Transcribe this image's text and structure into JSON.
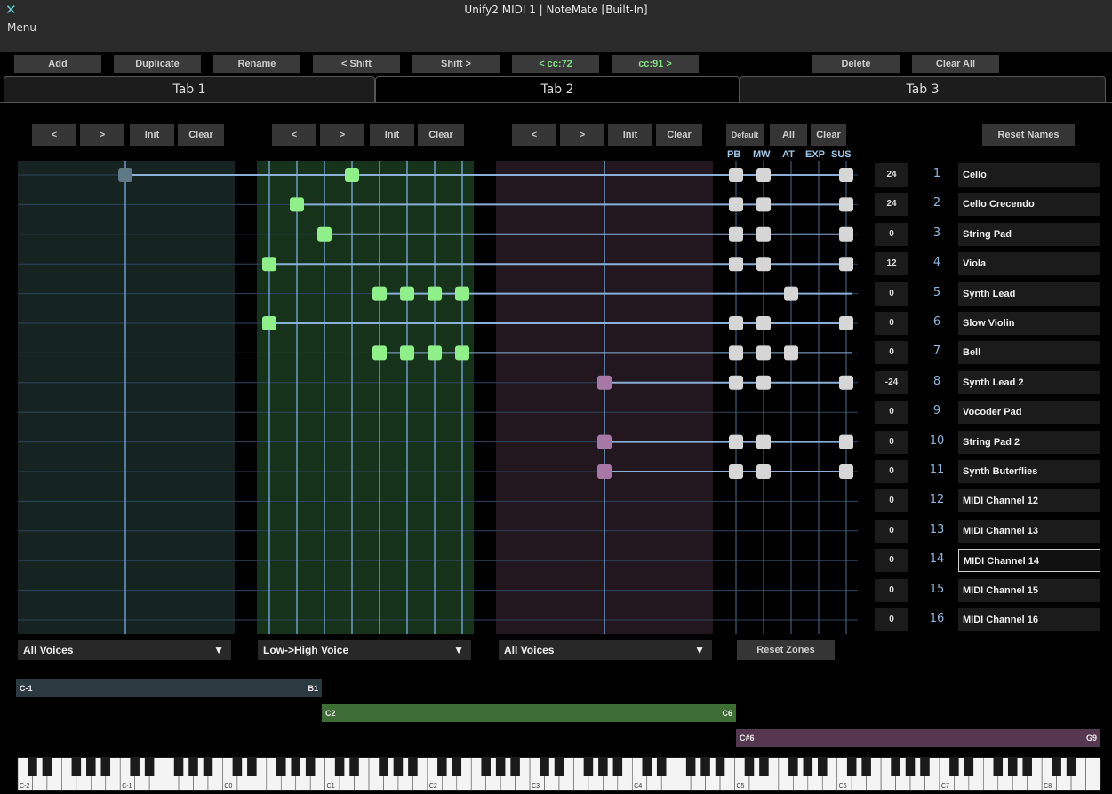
{
  "window": {
    "title": "Unify2 MIDI 1 | NoteMate [Built-In]"
  },
  "menu": {
    "label": "Menu"
  },
  "toolbar": {
    "add": "Add",
    "duplicate": "Duplicate",
    "rename": "Rename",
    "shift_left": "< Shift",
    "shift_right": "Shift >",
    "cc_prev": "< cc:72",
    "cc_next": "cc:91 >",
    "delete": "Delete",
    "clear_all": "Clear All"
  },
  "tabs": [
    "Tab 1",
    "Tab 2",
    "Tab 3"
  ],
  "active_tab": 1,
  "zone_controls": {
    "prev": "<",
    "next": ">",
    "init": "Init",
    "clear": "Clear"
  },
  "cc_controls": {
    "default": "Default",
    "all": "All",
    "clear": "Clear"
  },
  "reset_names": "Reset Names",
  "cc_headers": [
    "PB",
    "MW",
    "AT",
    "EXP",
    "SUS"
  ],
  "zone_colors": [
    "#5e7886",
    "#8ff08a",
    "#a778a6"
  ],
  "channels": [
    {
      "ch": "1",
      "trans": "24",
      "name": "Cello",
      "zones": [
        0,
        3
      ],
      "cc": [
        0,
        1,
        4
      ]
    },
    {
      "ch": "2",
      "trans": "24",
      "name": "Cello Crecendo",
      "zones": [
        1
      ],
      "cc": [
        0,
        1,
        4
      ]
    },
    {
      "ch": "3",
      "trans": "0",
      "name": "String Pad",
      "zones": [
        2
      ],
      "cc": [
        0,
        1,
        4
      ]
    },
    {
      "ch": "4",
      "trans": "12",
      "name": "Viola",
      "zones": [
        0
      ],
      "cc": [
        0,
        1,
        4
      ]
    },
    {
      "ch": "5",
      "trans": "0",
      "name": "Synth Lead",
      "zones": [
        4,
        5,
        6,
        7
      ],
      "cc": [
        2
      ]
    },
    {
      "ch": "6",
      "trans": "0",
      "name": "Slow Violin",
      "zones": [
        0
      ],
      "cc": [
        0,
        1,
        4
      ]
    },
    {
      "ch": "7",
      "trans": "0",
      "name": "Bell",
      "zones": [
        4,
        5,
        6,
        7
      ],
      "cc": [
        0,
        1,
        2
      ]
    },
    {
      "ch": "8",
      "trans": "-24",
      "name": "Synth Lead 2",
      "zones": [
        8
      ],
      "cc": [
        0,
        1,
        4
      ]
    },
    {
      "ch": "9",
      "trans": "0",
      "name": "Vocoder Pad",
      "zones": [],
      "cc": []
    },
    {
      "ch": "10",
      "trans": "0",
      "name": "String Pad 2",
      "zones": [
        8
      ],
      "cc": [
        0,
        1,
        4
      ]
    },
    {
      "ch": "11",
      "trans": "0",
      "name": "Synth Buterflies",
      "zones": [
        8
      ],
      "cc": [
        0,
        1,
        4
      ]
    },
    {
      "ch": "12",
      "trans": "0",
      "name": "MIDI Channel 12",
      "zones": [],
      "cc": []
    },
    {
      "ch": "13",
      "trans": "0",
      "name": "MIDI Channel 13",
      "zones": [],
      "cc": []
    },
    {
      "ch": "14",
      "trans": "0",
      "name": "MIDI Channel 14",
      "zones": [],
      "cc": []
    },
    {
      "ch": "15",
      "trans": "0",
      "name": "MIDI Channel 15",
      "zones": [],
      "cc": []
    },
    {
      "ch": "16",
      "trans": "0",
      "name": "MIDI Channel 16",
      "zones": [],
      "cc": []
    }
  ],
  "zone_modes": [
    "All Voices",
    "Low->High Voice",
    "All Voices"
  ],
  "reset_zones": "Reset Zones",
  "key_ranges": [
    {
      "low": "C-1",
      "high": "B1",
      "color": "#2a3a40"
    },
    {
      "low": "C2",
      "high": "C6",
      "color": "#3e6e36"
    },
    {
      "low": "C#6",
      "high": "G9",
      "color": "#55384f"
    }
  ],
  "keyboard_labels": [
    "C-2",
    "C-1",
    "C0",
    "C1",
    "C2",
    "C3",
    "C4",
    "C5",
    "C6",
    "C7",
    "C8"
  ]
}
